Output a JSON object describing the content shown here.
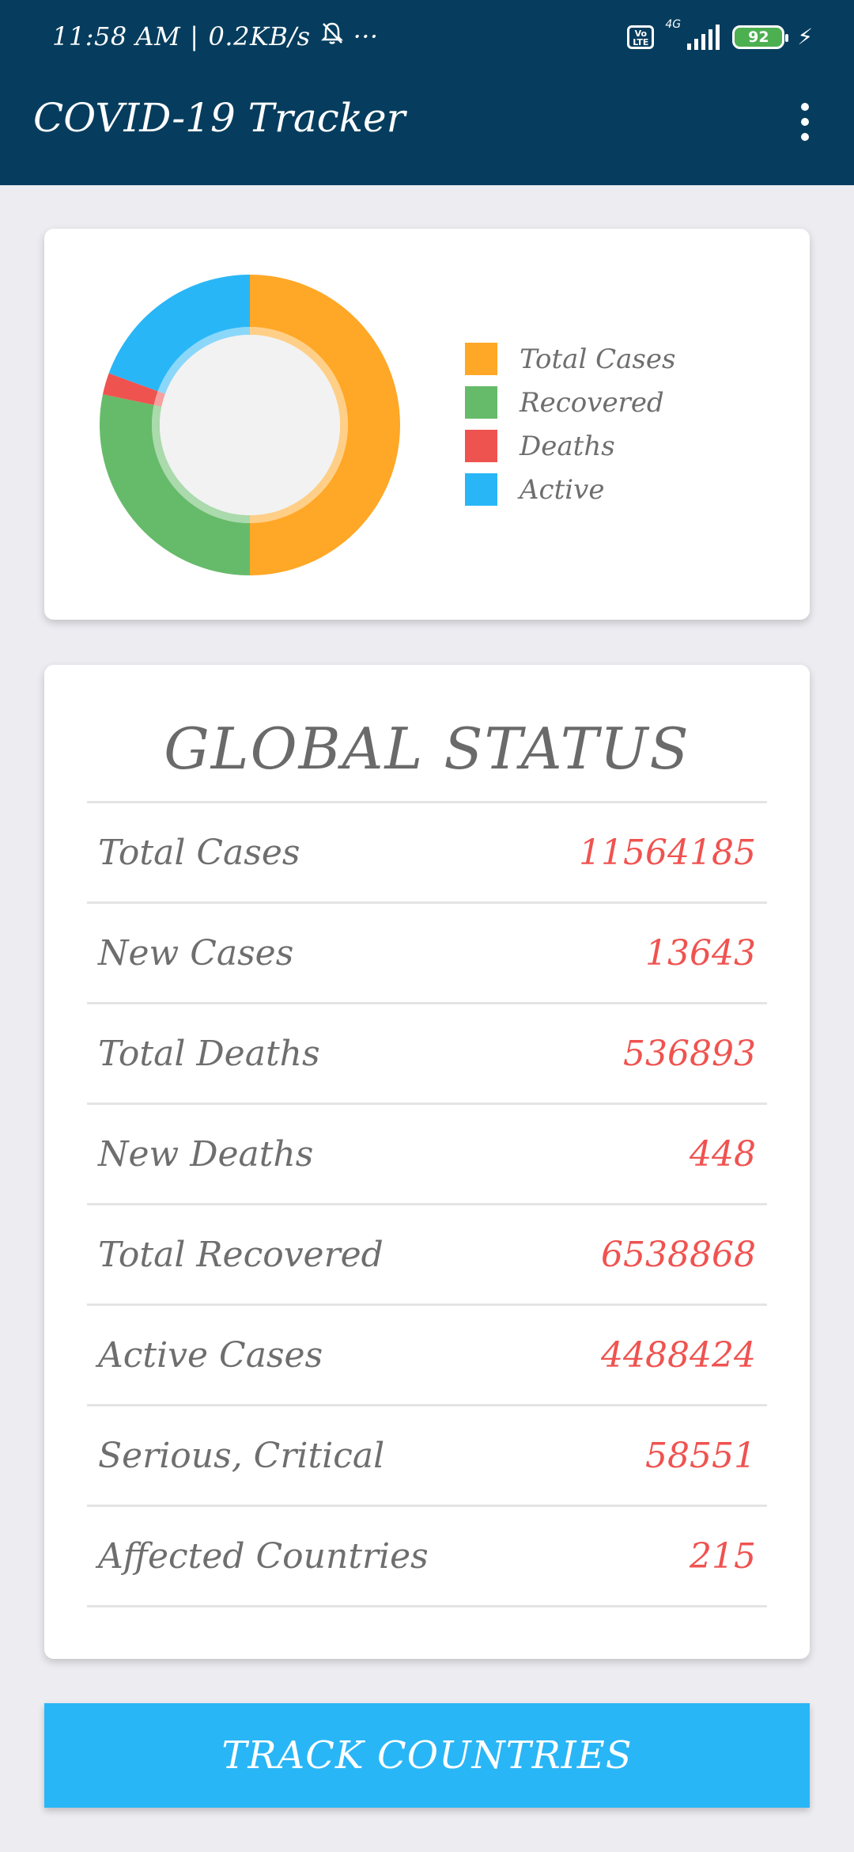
{
  "status_bar": {
    "time": "11:58 AM",
    "speed": "0.2KB/s",
    "more": "···",
    "network": "4G",
    "volte": "Vo LTE",
    "battery": "92"
  },
  "app_bar": {
    "title": "COVID-19 Tracker",
    "menu_icon": "more-vert-icon"
  },
  "chart_data": {
    "type": "pie",
    "categories": [
      "Total Cases",
      "Recovered",
      "Deaths",
      "Active"
    ],
    "values": [
      11564185,
      6538868,
      536893,
      4488424
    ],
    "colors": [
      "#FFA726",
      "#66BB6A",
      "#EF5350",
      "#29B6F6"
    ],
    "legend_position": "right",
    "title": "",
    "xlabel": "",
    "ylabel": ""
  },
  "global_status": {
    "title": "GLOBAL STATUS",
    "rows": [
      {
        "label": "Total Cases",
        "value": "11564185"
      },
      {
        "label": "New Cases",
        "value": "13643"
      },
      {
        "label": "Total Deaths",
        "value": "536893"
      },
      {
        "label": "New Deaths",
        "value": "448"
      },
      {
        "label": "Total Recovered",
        "value": "6538868"
      },
      {
        "label": "Active Cases",
        "value": "4488424"
      },
      {
        "label": "Serious, Critical",
        "value": "58551"
      },
      {
        "label": "Affected Countries",
        "value": "215"
      }
    ]
  },
  "track_button": {
    "label": "TRACK COUNTRIES"
  },
  "colors": {
    "app_bar": "#063D5E",
    "accent": "#29B6F6",
    "value_red": "#EF5350",
    "background": "#ECECF1"
  }
}
